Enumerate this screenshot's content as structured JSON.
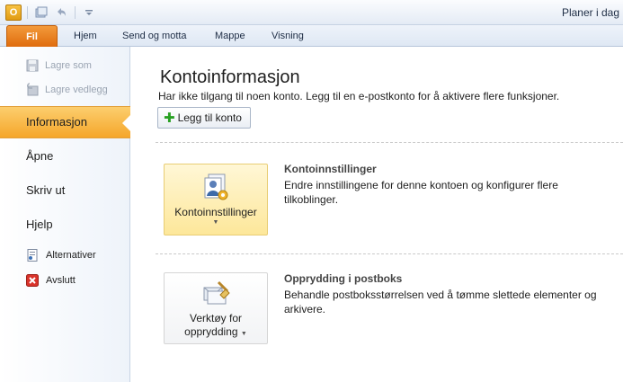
{
  "window": {
    "title": "Planer i dag"
  },
  "ribbon": {
    "file_tab": "Fil",
    "tabs": [
      "Hjem",
      "Send og motta",
      "Mappe",
      "Visning"
    ]
  },
  "backstage": {
    "top_items": [
      {
        "label": "Lagre som",
        "icon": "save-as-icon"
      },
      {
        "label": "Lagre vedlegg",
        "icon": "save-attachments-icon"
      }
    ],
    "nav": [
      {
        "label": "Informasjon",
        "active": true
      },
      {
        "label": "Åpne"
      },
      {
        "label": "Skriv ut"
      },
      {
        "label": "Hjelp"
      }
    ],
    "sub_items": [
      {
        "label": "Alternativer",
        "icon": "options-icon"
      },
      {
        "label": "Avslutt",
        "icon": "exit-icon"
      }
    ]
  },
  "main": {
    "title": "Kontoinformasjon",
    "subtitle": "Har ikke tilgang til noen konto. Legg til en e-postkonto for å aktivere flere funksjoner.",
    "add_account": "Legg til konto",
    "sections": [
      {
        "button": "Kontoinnstillinger",
        "title": "Kontoinnstillinger",
        "description": "Endre innstillingene for denne kontoen og konfigurer flere tilkoblinger."
      },
      {
        "button_line1": "Verktøy for",
        "button_line2": "opprydding",
        "title": "Opprydding i postboks",
        "description": "Behandle postboksstørrelsen ved å tømme slettede elementer og arkivere."
      }
    ]
  },
  "colors": {
    "file_tab": "#e1730f",
    "active_nav": "#f7b13d",
    "highlight_button": "#fde79a"
  }
}
